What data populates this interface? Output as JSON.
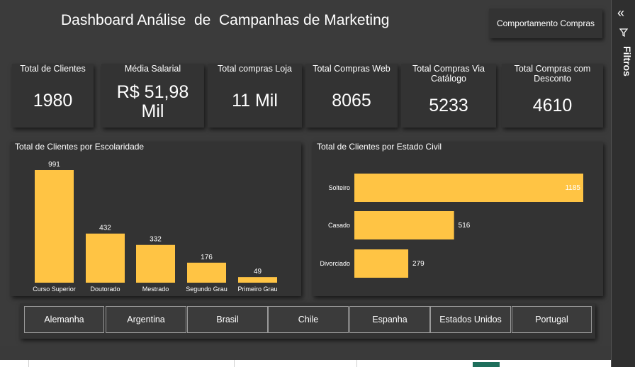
{
  "header": {
    "title": "Dashboard Análise  de  Campanhas de Marketing",
    "comport_button": "Comportamento Compras"
  },
  "kpis": [
    {
      "label": "Total de Clientes",
      "value": "1980"
    },
    {
      "label": "Média Salarial",
      "value": "R$ 51,98 Mil"
    },
    {
      "label": "Total compras Loja",
      "value": "11 Mil"
    },
    {
      "label": "Total Compras Web",
      "value": "8065"
    },
    {
      "label": "Total Compras Via Catálogo",
      "value": "5233"
    },
    {
      "label": "Total Compras com Desconto",
      "value": "4610"
    }
  ],
  "chart_data": [
    {
      "type": "bar",
      "title": "Total de Clientes por Escolaridade",
      "categories": [
        "Curso Superior",
        "Doutorado",
        "Mestrado",
        "Segundo Grau",
        "Primeiro Grau"
      ],
      "values": [
        991,
        432,
        332,
        176,
        49
      ],
      "orientation": "vertical",
      "color": "#FFC444"
    },
    {
      "type": "bar",
      "title": "Total de Clientes por Estado Civil",
      "categories": [
        "Solteiro",
        "Casado",
        "Divorciado"
      ],
      "values": [
        1185,
        516,
        279
      ],
      "orientation": "horizontal",
      "color": "#FFC444"
    }
  ],
  "countries": [
    "Alemanha",
    "Argentina",
    "Brasil",
    "Chile",
    "Espanha",
    "Estados Unidos",
    "Portugal"
  ],
  "side_panel": {
    "collapse_icon": "«",
    "label": "Filtros"
  },
  "colors": {
    "background": "#3b3b3b",
    "card": "#333333",
    "bar": "#FFC444"
  }
}
